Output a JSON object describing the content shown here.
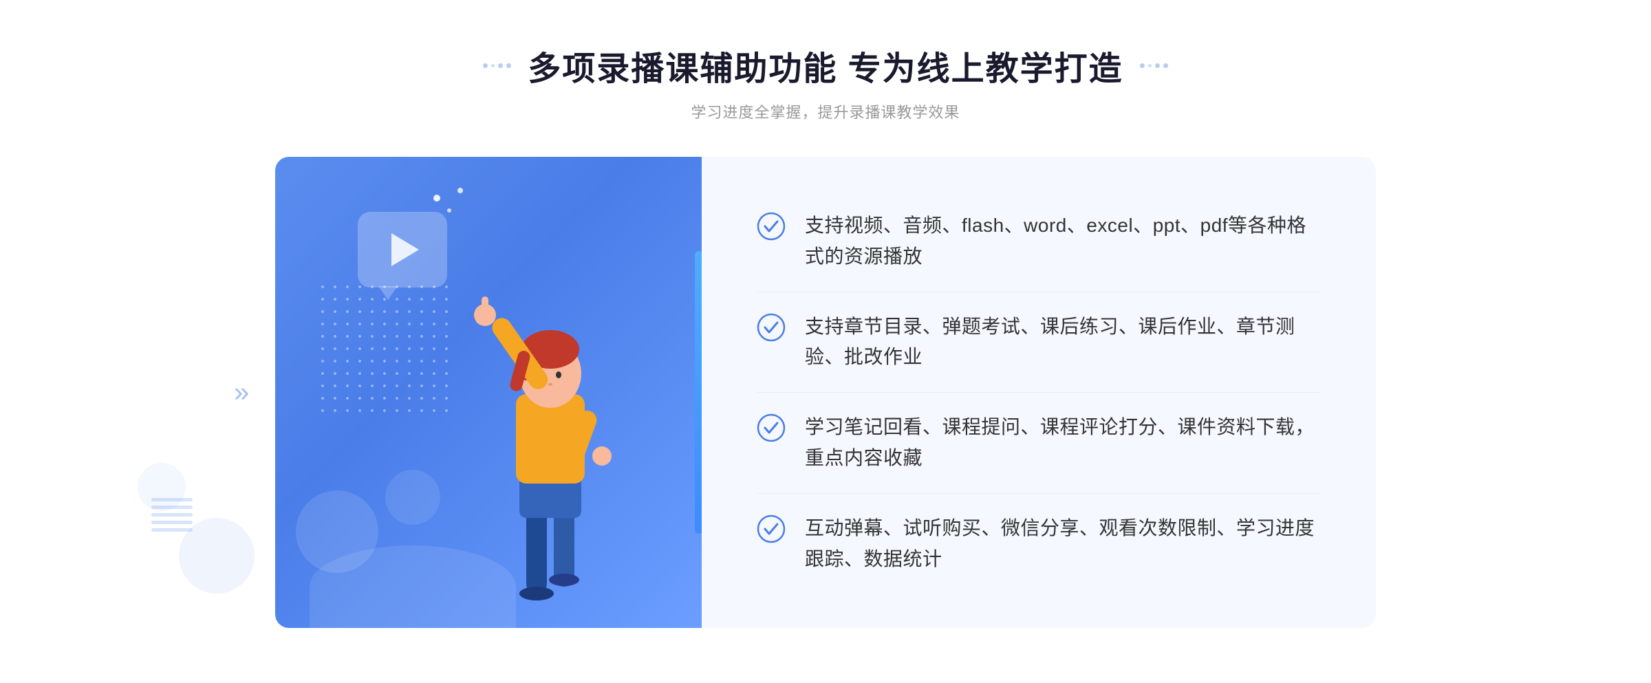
{
  "header": {
    "title": "多项录播课辅助功能 专为线上教学打造",
    "subtitle": "学习进度全掌握，提升录播课教学效果"
  },
  "features": [
    {
      "id": 1,
      "text": "支持视频、音频、flash、word、excel、ppt、pdf等各种格式的资源播放"
    },
    {
      "id": 2,
      "text": "支持章节目录、弹题考试、课后练习、课后作业、章节测验、批改作业"
    },
    {
      "id": 3,
      "text": "学习笔记回看、课程提问、课程评论打分、课件资料下载，重点内容收藏"
    },
    {
      "id": 4,
      "text": "互动弹幕、试听购买、微信分享、观看次数限制、学习进度跟踪、数据统计"
    }
  ],
  "icons": {
    "check": "✓",
    "play": "▶",
    "arrow_right": "»"
  },
  "colors": {
    "primary": "#4a7de8",
    "primary_light": "#6b9eff",
    "bg_light": "#f5f8ff",
    "text_dark": "#1a1a2e",
    "text_gray": "#999999",
    "text_feature": "#333333"
  }
}
